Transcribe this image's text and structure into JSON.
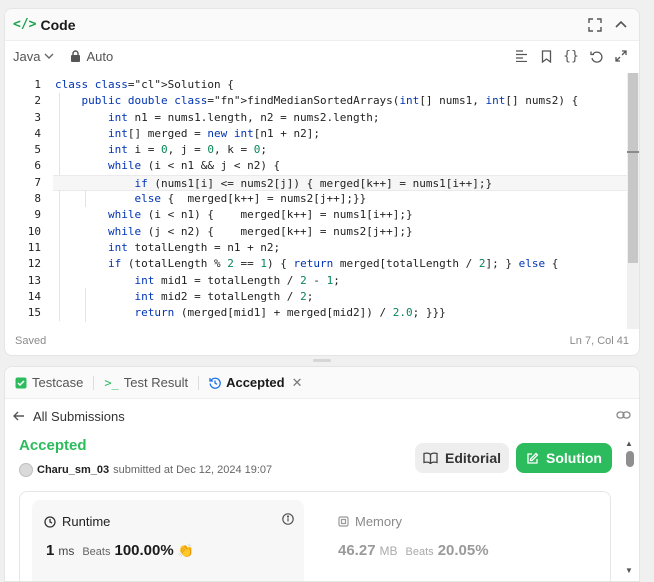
{
  "code_panel": {
    "title": "Code",
    "language": "Java",
    "mode": "Auto",
    "status": "Saved",
    "cursor": "Ln 7, Col 41",
    "lines": [
      "class Solution {",
      "    public double findMedianSortedArrays(int[] nums1, int[] nums2) {",
      "        int n1 = nums1.length, n2 = nums2.length;",
      "        int[] merged = new int[n1 + n2];",
      "        int i = 0, j = 0, k = 0;",
      "        while (i < n1 && j < n2) {",
      "            if (nums1[i] <= nums2[j]) { merged[k++] = nums1[i++];}",
      "            else {  merged[k++] = nums2[j++];}}",
      "        while (i < n1) {    merged[k++] = nums1[i++];}",
      "        while (j < n2) {    merged[k++] = nums2[j++];}",
      "        int totalLength = n1 + n2;",
      "        if (totalLength % 2 == 1) { return merged[totalLength / 2]; } else {",
      "            int mid1 = totalLength / 2 - 1;",
      "            int mid2 = totalLength / 2;",
      "            return (merged[mid1] + merged[mid2]) / 2.0; }}}"
    ],
    "active_line": 7
  },
  "result_panel": {
    "tabs": {
      "testcase": "Testcase",
      "test_result": "Test Result",
      "accepted": "Accepted"
    },
    "back_label": "All Submissions",
    "verdict": "Accepted",
    "submitter": {
      "name": "Charu_sm_03",
      "submitted_text": "submitted at Dec 12, 2024 19:07"
    },
    "editorial_label": "Editorial",
    "solution_label": "Solution",
    "runtime": {
      "title": "Runtime",
      "value": "1",
      "unit": "ms",
      "beats_label": "Beats",
      "percent": "100.00%"
    },
    "memory": {
      "title": "Memory",
      "value": "46.27",
      "unit": "MB",
      "beats_label": "Beats",
      "percent": "20.05%"
    }
  },
  "colors": {
    "accent_green": "#2cbb5d",
    "keyword_blue": "#0033b3"
  }
}
